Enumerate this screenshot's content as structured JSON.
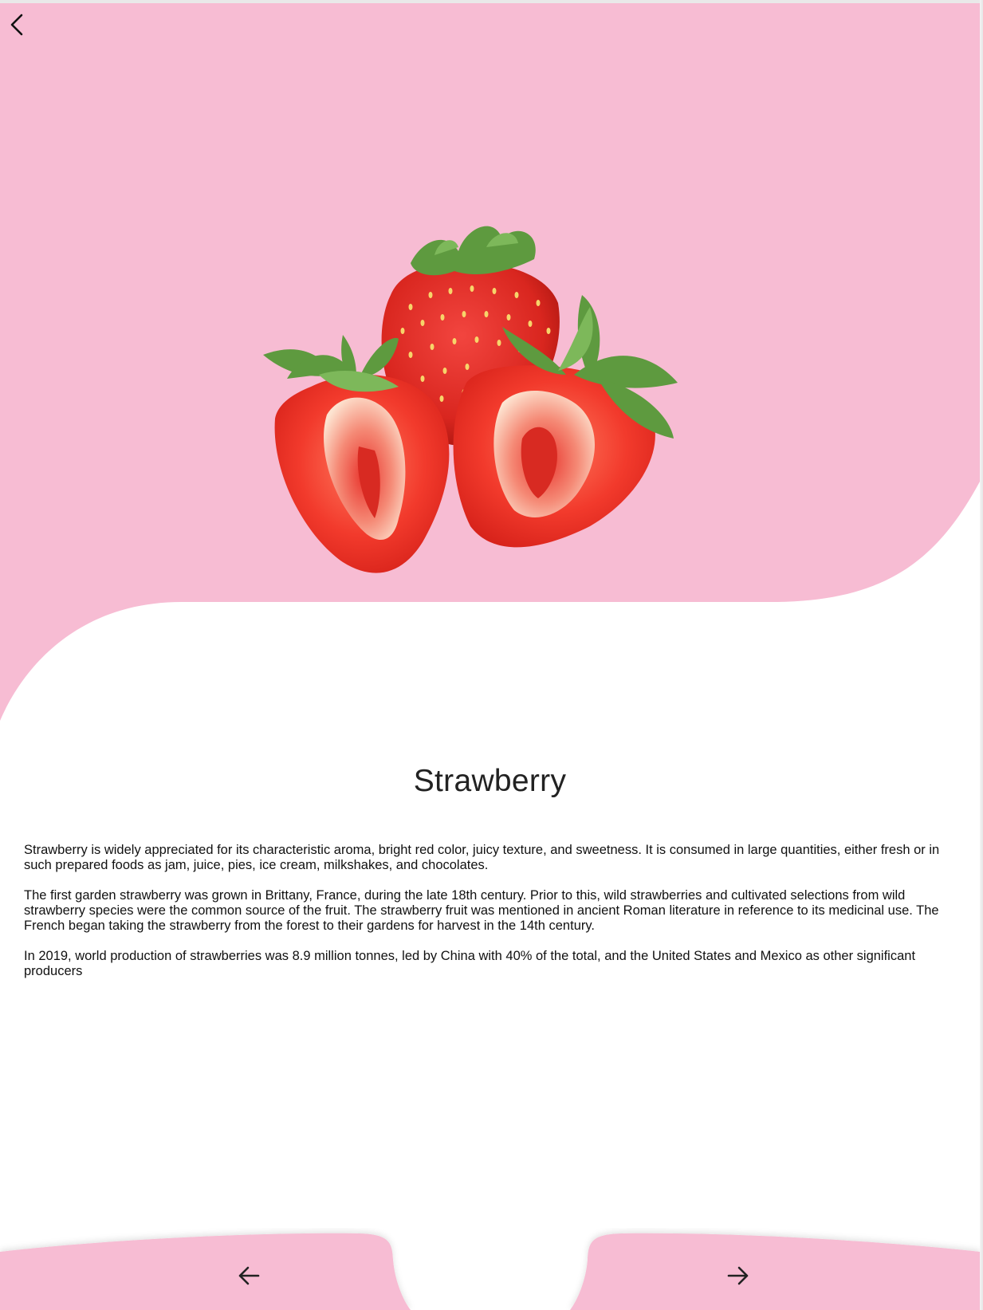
{
  "fruit": {
    "name": "Strawberry",
    "paragraphs": [
      "Strawberry is widely appreciated for its characteristic aroma, bright red color, juicy texture, and sweetness. It is consumed in large quantities, either fresh or in such prepared foods as jam, juice, pies, ice cream, milkshakes, and chocolates.",
      "The first garden strawberry was grown in Brittany, France, during the late 18th century. Prior to this, wild strawberries and cultivated selections from wild strawberry species were the common source of the fruit. The strawberry fruit was mentioned in ancient Roman literature in reference to its medicinal use. The French began taking the strawberry from the forest to their gardens for harvest in the 14th century.",
      "In 2019, world production of strawberries was 8.9 million tonnes, led by China with 40% of the total, and the United States and Mexico as other significant producers"
    ]
  },
  "icons": {
    "back": "chevron-left-icon",
    "prev": "arrow-left-icon",
    "next": "arrow-right-icon"
  },
  "colors": {
    "accent_pink": "#F7BCD3",
    "background": "#FFFFFF",
    "text": "#111111",
    "strawberry_red": "#E8322E",
    "leaf_green": "#5E9A3F"
  }
}
